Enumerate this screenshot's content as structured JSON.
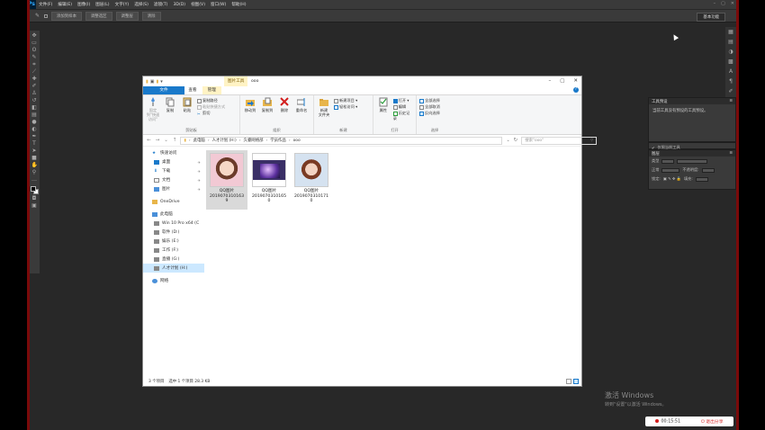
{
  "ps": {
    "logo": "Ps",
    "menu": [
      "文件(F)",
      "编辑(E)",
      "图像(I)",
      "图层(L)",
      "文字(Y)",
      "选择(S)",
      "滤镜(T)",
      "3D(D)",
      "视图(V)",
      "窗口(W)",
      "帮助(H)"
    ],
    "options": [
      "添加到样本",
      "调整选区",
      "调整层",
      "清除"
    ],
    "workspace": "基本功能",
    "panels": {
      "tool_presets": {
        "title": "工具预设",
        "empty_text": "当前工具没有预设的工具预设。",
        "footer": "仅限当前工具"
      },
      "layers": {
        "title": "图层",
        "kind": "类型",
        "blend": "正常",
        "opacity_label": "不透明度:",
        "lock_label": "锁定:",
        "fill_label": "填充:"
      }
    },
    "win_controls": [
      "–",
      "▢",
      "✕"
    ]
  },
  "explorer": {
    "title": "ooo",
    "context_tab": "图片工具",
    "ribbon_tabs": [
      "文件",
      "主页",
      "共享",
      "查看",
      "管理"
    ],
    "active_tab": "主页",
    "ribbon": {
      "clipboard": {
        "label": "剪贴板",
        "pin": "固定到\"快速访问\"",
        "copy": "复制",
        "paste": "粘贴",
        "copy_path": "复制路径",
        "paste_shortcut": "粘贴快捷方式",
        "cut": "剪切"
      },
      "organize": {
        "label": "组织",
        "move_to": "移动到",
        "copy_to": "复制到",
        "delete": "删除",
        "rename": "重命名"
      },
      "new": {
        "label": "新建",
        "new_folder": "新建\n文件夹",
        "new_item": "新建项目 ▾",
        "easy_access": "轻松访问 ▾"
      },
      "open": {
        "label": "打开",
        "properties": "属性",
        "open": "打开 ▾",
        "edit": "编辑",
        "history": "历史记录"
      },
      "select": {
        "label": "选择",
        "select_all": "全部选择",
        "select_none": "全部取消",
        "invert": "反向选择"
      }
    },
    "address": [
      "此电脑",
      "人才计划 (H:)",
      "久睿网络部",
      "学员作品",
      "ooo"
    ],
    "search_placeholder": "搜索\"ooo\"",
    "nav": [
      {
        "label": "快速访问",
        "lvl": 0,
        "icon": "star-icon"
      },
      {
        "label": "桌面",
        "lvl": 1,
        "icon": "desktop-icon",
        "pin": true
      },
      {
        "label": "下载",
        "lvl": 1,
        "icon": "download-icon",
        "pin": true
      },
      {
        "label": "文档",
        "lvl": 1,
        "icon": "document-icon",
        "pin": true
      },
      {
        "label": "图片",
        "lvl": 1,
        "icon": "picture-icon",
        "pin": true
      },
      {
        "label": "OneDrive",
        "lvl": 0,
        "icon": "cloud-icon"
      },
      {
        "label": "此电脑",
        "lvl": 0,
        "icon": "computer-icon"
      },
      {
        "label": "Win 10 Pro x64 (C",
        "lvl": 1,
        "icon": "drive-icon"
      },
      {
        "label": "软件 (D:)",
        "lvl": 1,
        "icon": "drive-icon"
      },
      {
        "label": "娱乐 (E:)",
        "lvl": 1,
        "icon": "drive-icon"
      },
      {
        "label": "工作 (F:)",
        "lvl": 1,
        "icon": "drive-icon"
      },
      {
        "label": "直播 (G:)",
        "lvl": 1,
        "icon": "drive-icon"
      },
      {
        "label": "人才计划 (H:)",
        "lvl": 1,
        "icon": "drive-icon",
        "selected": true
      },
      {
        "label": "网络",
        "lvl": 0,
        "icon": "network-icon"
      }
    ],
    "files": [
      {
        "name": "QQ图片\n2019070310163\n9",
        "selected": true
      },
      {
        "name": "QQ图片\n2019070310165\n0",
        "selected": false
      },
      {
        "name": "QQ图片\n2019070310171\n0",
        "selected": false
      }
    ],
    "status": {
      "count": "3 个项目",
      "selection": "选中 1 个项目  28.3 KB"
    }
  },
  "watermark": {
    "line1": "激活 Windows",
    "line2": "转到\"设置\"以激活 Windows。"
  },
  "recorder": {
    "time": "00:15:51",
    "stop": "退出分享"
  }
}
